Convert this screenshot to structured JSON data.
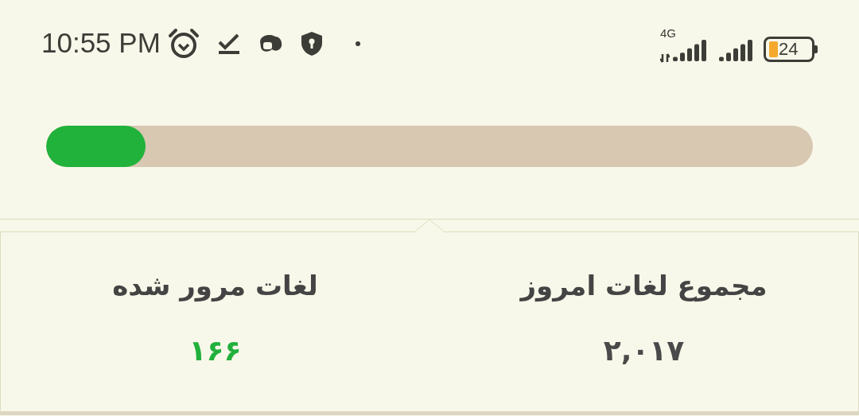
{
  "status_bar": {
    "time": "10:55 PM",
    "network": "4G",
    "battery": "24"
  },
  "progress": {
    "level": 0.13
  },
  "stats": [
    {
      "label": "مجموع لغات امروز",
      "value": "۲,۰۱۷",
      "color": "#4a4a4a"
    },
    {
      "label": "لغات مرور شده",
      "value": "۱۶۶",
      "color": "#22b03c"
    }
  ]
}
